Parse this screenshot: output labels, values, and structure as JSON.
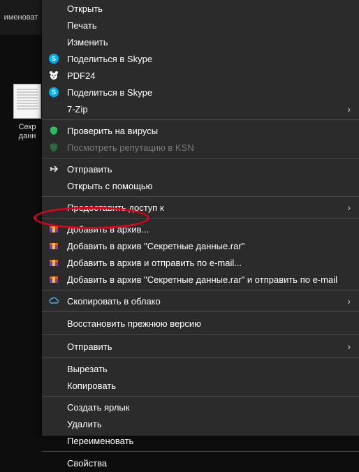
{
  "header_partial": "именоват",
  "file": {
    "name_line1": "Секр",
    "name_line2": "данн"
  },
  "menu": {
    "open": "Открыть",
    "print": "Печать",
    "edit": "Изменить",
    "share_skype_1": "Поделиться в Skype",
    "pdf24": "PDF24",
    "share_skype_2": "Поделиться в Skype",
    "seven_zip": "7-Zip",
    "scan": "Проверить на вирусы",
    "ksn": "Посмотреть репутацию в KSN",
    "send": "Отправить",
    "open_with": "Открыть с помощью",
    "give_access": "Предоставить доступ к",
    "add_archive": "Добавить в архив...",
    "add_archive_name": "Добавить в архив \"Секретные данные.rar\"",
    "add_archive_mail": "Добавить в архив и отправить по e-mail...",
    "add_archive_name_mail": "Добавить в архив \"Секретные данные.rar\" и отправить по e-mail",
    "copy_cloud": "Скопировать в облако",
    "restore": "Восстановить прежнюю версию",
    "send2": "Отправить",
    "cut": "Вырезать",
    "copy": "Копировать",
    "shortcut": "Создать ярлык",
    "delete": "Удалить",
    "rename": "Переименовать",
    "props": "Свойства"
  }
}
